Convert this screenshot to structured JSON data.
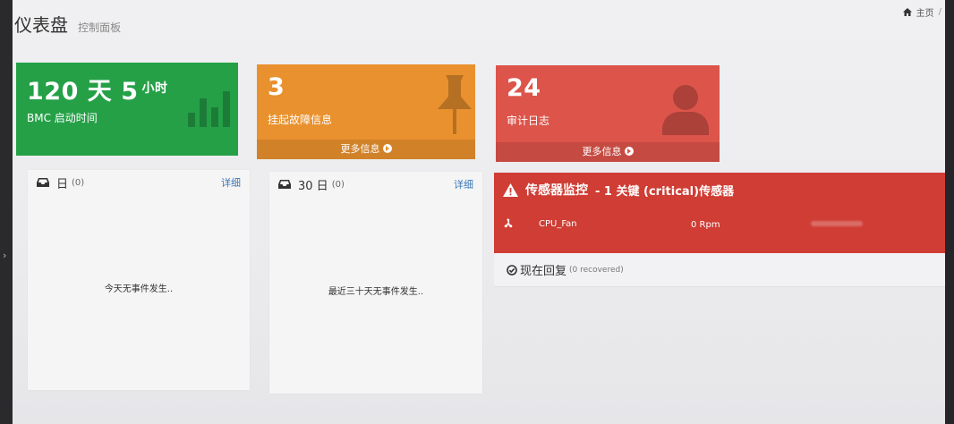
{
  "header": {
    "title": "仪表盘",
    "subtitle": "控制面板"
  },
  "breadcrumb": {
    "home_label": "主页",
    "separator": "/"
  },
  "cards": {
    "uptime": {
      "days": "120",
      "days_unit": "天",
      "hours": "5",
      "hours_unit": "小时",
      "label": "BMC 启动时间",
      "color": "#25a047"
    },
    "faults": {
      "value": "3",
      "label": "挂起故障信息",
      "more": "更多信息",
      "color": "#e9912e"
    },
    "audit": {
      "value": "24",
      "label": "审计日志",
      "more": "更多信息",
      "color": "#dc544a"
    }
  },
  "panels": {
    "today": {
      "title": "日",
      "count": "(0)",
      "detail": "详细",
      "empty": "今天无事件发生.."
    },
    "month": {
      "title": "30 日",
      "count": "(0)",
      "detail": "详细",
      "empty": "最近三十天无事件发生.."
    }
  },
  "sensor": {
    "title": "传感器监控",
    "subtitle": "- 1 关键 (critical)传感器",
    "rows": [
      {
        "name": "CPU_Fan",
        "value": "0 Rpm",
        "icon": "fan-icon"
      }
    ],
    "recovered_label": "现在回复",
    "recovered_note": "(0 recovered)",
    "color": "#cf3d34"
  },
  "nav": {
    "toggle": "›"
  }
}
